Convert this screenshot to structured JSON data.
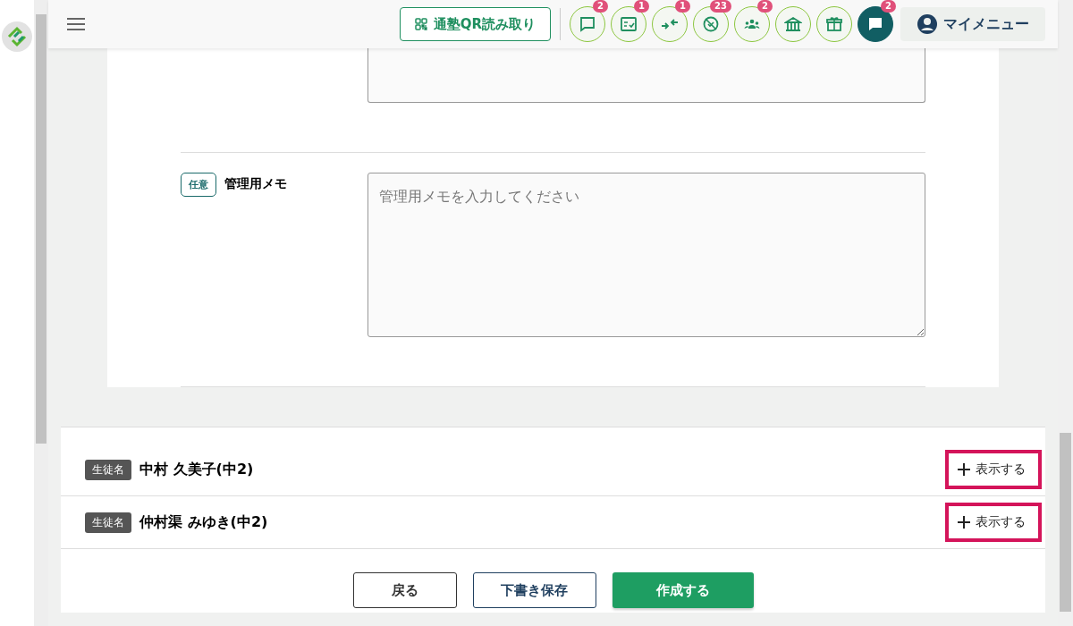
{
  "header": {
    "qr_button": "通塾QR読み取り",
    "icon_buttons": [
      {
        "kind": "chat",
        "badge": "2"
      },
      {
        "kind": "checklist",
        "badge": "1"
      },
      {
        "kind": "merge",
        "badge": "1"
      },
      {
        "kind": "blocked",
        "badge": "23"
      },
      {
        "kind": "group",
        "badge": "2"
      },
      {
        "kind": "school"
      },
      {
        "kind": "gift"
      },
      {
        "kind": "message",
        "badge": "2"
      }
    ],
    "my_menu": "マイメニュー"
  },
  "memo": {
    "tag": "任意",
    "label": "管理用メモ",
    "placeholder": "管理用メモを入力してください"
  },
  "students": [
    {
      "tag": "生徒名",
      "name": "中村 久美子(中2)",
      "toggle": "表示する",
      "highlighted": true
    },
    {
      "tag": "生徒名",
      "name": "仲村渠 みゆき(中2)",
      "toggle": "表示する",
      "highlighted": true
    }
  ],
  "buttons": [
    {
      "kind": "back",
      "label": "戻る"
    },
    {
      "kind": "draft",
      "label": "下書き保存"
    },
    {
      "kind": "create",
      "label": "作成する"
    }
  ]
}
